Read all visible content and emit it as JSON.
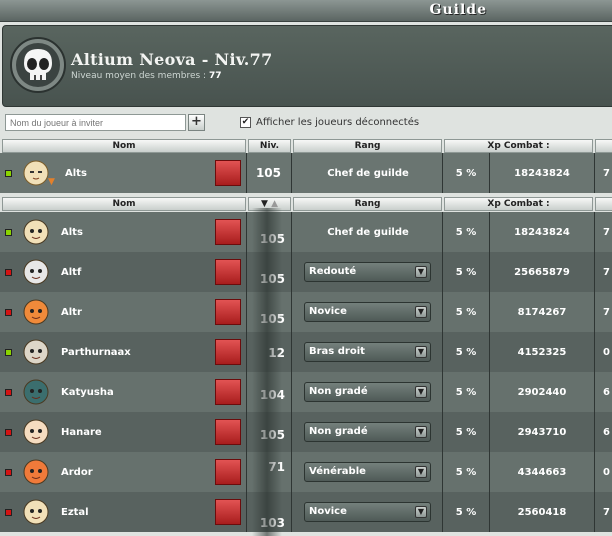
{
  "window": {
    "title": "Guilde"
  },
  "guild": {
    "name": "Altium Neova - Niv.77",
    "avg_label": "Niveau moyen des membres :",
    "avg_value": "77"
  },
  "invite": {
    "placeholder": "Nom du joueur à inviter",
    "add_label": "+"
  },
  "options": {
    "show_disconnected_label": "Afficher les joueurs déconnectés",
    "show_disconnected_checked": true
  },
  "columns": {
    "name": "Nom",
    "level": "Niv.",
    "rank": "Rang",
    "xp": "Xp Combat :"
  },
  "me": {
    "name": "Alts",
    "level": "105",
    "rank": "Chef de guilde",
    "xp_pct": "5 %",
    "xp": "18243824",
    "extra": "7",
    "status": "online"
  },
  "members": [
    {
      "name": "Alts",
      "status": "online",
      "level": "105",
      "rank": "Chef de guilde",
      "rank_editable": false,
      "xp_pct": "5 %",
      "xp": "18243824",
      "extra": "7"
    },
    {
      "name": "Altf",
      "status": "offline",
      "level": "105",
      "rank": "Redouté",
      "rank_editable": true,
      "xp_pct": "5 %",
      "xp": "25665879",
      "extra": "7"
    },
    {
      "name": "Altr",
      "status": "offline",
      "level": "105",
      "rank": "Novice",
      "rank_editable": true,
      "xp_pct": "5 %",
      "xp": "8174267",
      "extra": "7"
    },
    {
      "name": "Parthurnaax",
      "status": "online",
      "level": "12",
      "rank": "Bras droit",
      "rank_editable": true,
      "xp_pct": "5 %",
      "xp": "4152325",
      "extra": "0"
    },
    {
      "name": "Katyusha",
      "status": "offline",
      "level": "104",
      "rank": "Non gradé",
      "rank_editable": true,
      "xp_pct": "5 %",
      "xp": "2902440",
      "extra": "6"
    },
    {
      "name": "Hanare",
      "status": "offline",
      "level": "105",
      "rank": "Non gradé",
      "rank_editable": true,
      "xp_pct": "5 %",
      "xp": "2943710",
      "extra": "6"
    },
    {
      "name": "Ardor",
      "status": "offline",
      "level": "71",
      "rank": "Vénérable",
      "rank_editable": true,
      "xp_pct": "5 %",
      "xp": "4344663",
      "extra": "0"
    },
    {
      "name": "Eztal",
      "status": "offline",
      "level": "103",
      "rank": "Novice",
      "rank_editable": true,
      "xp_pct": "5 %",
      "xp": "2560418",
      "extra": "7"
    }
  ],
  "colors": {
    "online": "#8ad400",
    "offline": "#d41313",
    "row_a": "#66716d",
    "row_b": "#58625f",
    "header_bg": "#4b5652"
  }
}
